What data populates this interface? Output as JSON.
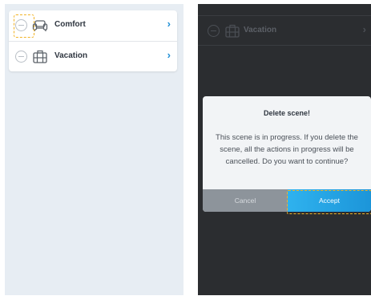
{
  "left_screen": {
    "scenes": [
      {
        "label": "Comfort",
        "icon": "sofa-icon"
      },
      {
        "label": "Vacation",
        "icon": "luggage-icon"
      }
    ]
  },
  "right_screen": {
    "background_scene": {
      "label": "Vacation",
      "icon": "luggage-icon"
    },
    "dialog": {
      "title": "Delete scene!",
      "message": "This scene is in progress. If you delete the scene, all the actions in progress will be cancelled. Do you want to continue?",
      "cancel_label": "Cancel",
      "accept_label": "Accept"
    }
  },
  "colors": {
    "accent": "#1f8fd6",
    "highlight": "#f2b325",
    "dark_background": "#2b2d30",
    "list_background": "#e7edf3"
  }
}
